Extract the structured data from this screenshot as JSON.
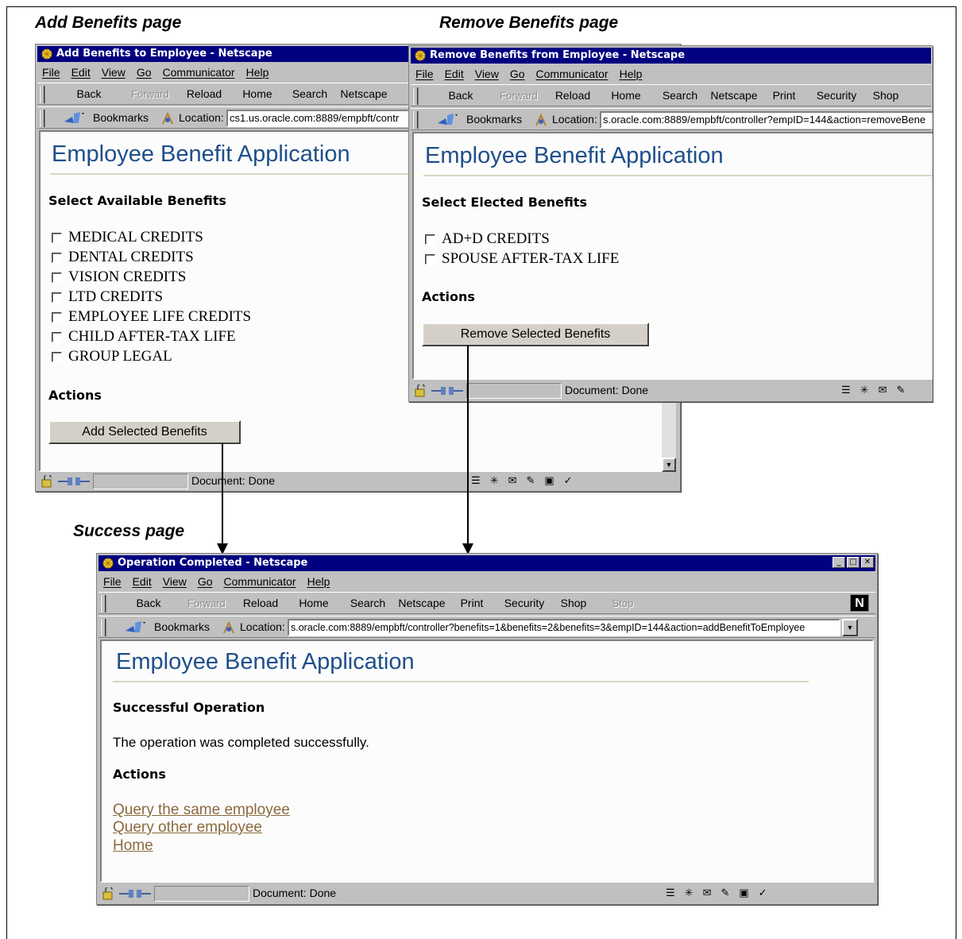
{
  "captions": {
    "add": "Add Benefits page",
    "remove": "Remove Benefits page",
    "success": "Success page"
  },
  "menu": [
    "File",
    "Edit",
    "View",
    "Go",
    "Communicator",
    "Help"
  ],
  "toolbar_buttons": {
    "back": "Back",
    "forward": "Forward",
    "reload": "Reload",
    "home": "Home",
    "search": "Search",
    "netscape": "Netscape",
    "print": "Print",
    "security": "Security",
    "shop": "Shop",
    "stop": "Stop"
  },
  "bookmarks_label": "Bookmarks",
  "location_label": "Location:",
  "status_done": "Document: Done",
  "app_title": "Employee Benefit Application",
  "add_window": {
    "title": "Add Benefits to Employee - Netscape",
    "url": "cs1.us.oracle.com:8889/empbft/contr",
    "section": "Select Available Benefits",
    "benefits": [
      "MEDICAL CREDITS",
      "DENTAL CREDITS",
      "VISION CREDITS",
      "LTD CREDITS",
      "EMPLOYEE LIFE CREDITS",
      "CHILD AFTER-TAX LIFE",
      "GROUP LEGAL"
    ],
    "actions": "Actions",
    "button": "Add Selected Benefits"
  },
  "remove_window": {
    "title": "Remove Benefits from Employee - Netscape",
    "url": "s.oracle.com:8889/empbft/controller?empID=144&action=removeBene",
    "section": "Select Elected Benefits",
    "benefits": [
      "AD+D CREDITS",
      "SPOUSE AFTER-TAX LIFE"
    ],
    "actions": "Actions",
    "button": "Remove Selected Benefits"
  },
  "success_window": {
    "title": "Operation Completed - Netscape",
    "url": "s.oracle.com:8889/empbft/controller?benefits=1&benefits=2&benefits=3&empID=144&action=addBenefitToEmployee",
    "section": "Successful Operation",
    "message": "The operation was completed successfully.",
    "actions": "Actions",
    "links": [
      "Query the same employee",
      "Query other employee",
      "Home"
    ]
  }
}
